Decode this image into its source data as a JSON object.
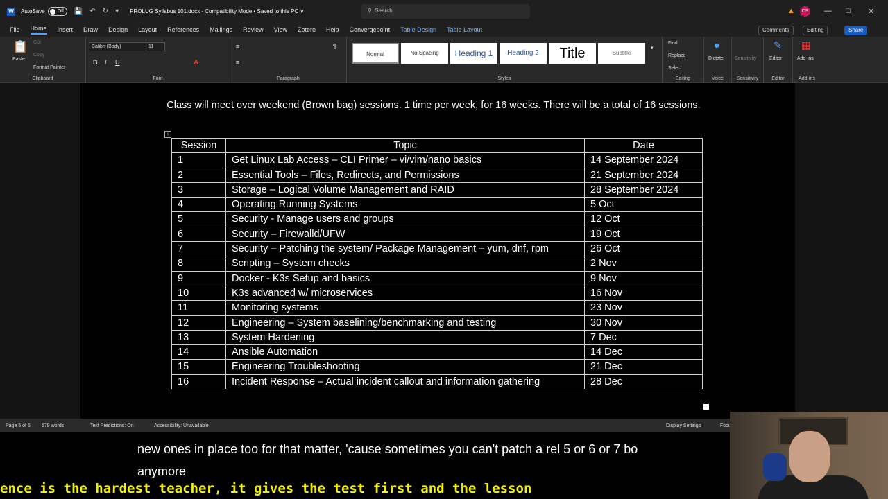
{
  "titlebar": {
    "autosave_label": "AutoSave",
    "autosave_state": "Off",
    "doc_title": "PROLUG Syllabus 101.docx  -  Compatibility Mode  •  Saved to this PC ∨",
    "search_placeholder": "Search",
    "avatar_initials": "CS"
  },
  "tabs": [
    "File",
    "Home",
    "Insert",
    "Draw",
    "Design",
    "Layout",
    "References",
    "Mailings",
    "Review",
    "View",
    "Zotero",
    "Help",
    "Convergepoint"
  ],
  "context_tabs": [
    "Table Design",
    "Table Layout"
  ],
  "active_tab": "Home",
  "top_right": {
    "comments": "Comments",
    "editing": "Editing",
    "share": "Share"
  },
  "ribbon": {
    "clipboard": {
      "paste": "Paste",
      "cut": "Cut",
      "copy": "Copy",
      "format_painter": "Format Painter",
      "label": "Clipboard"
    },
    "font": {
      "name": "Calibri (Body)",
      "size": "11",
      "label": "Font"
    },
    "paragraph": {
      "label": "Paragraph"
    },
    "styles": {
      "items": [
        "Normal",
        "No Spacing",
        "Heading 1",
        "Heading 2",
        "Title",
        "Subtitle"
      ],
      "label": "Styles"
    },
    "editing": {
      "find": "Find",
      "replace": "Replace",
      "select": "Select",
      "label": "Editing"
    },
    "voice": {
      "dictate": "Dictate",
      "label": "Voice"
    },
    "sensitivity": {
      "btn": "Sensitivity",
      "label": "Sensitivity"
    },
    "editor": {
      "btn": "Editor",
      "label": "Editor"
    },
    "addins": {
      "btn": "Add-ins",
      "label": "Add-ins"
    }
  },
  "document": {
    "intro": "Class will meet over weekend (Brown bag) sessions. 1 time per week, for 16 weeks. There will be a total of 16 sessions.",
    "table": {
      "headers": [
        "Session",
        "Topic",
        "Date"
      ],
      "rows": [
        [
          "1",
          "Get Linux Lab Access – CLI Primer – vi/vim/nano basics",
          "14 September 2024"
        ],
        [
          "2",
          "Essential Tools – Files, Redirects, and Permissions",
          "21 September 2024"
        ],
        [
          "3",
          "Storage – Logical Volume Management and RAID",
          "28 September 2024"
        ],
        [
          "4",
          "Operating Running Systems",
          "5 Oct"
        ],
        [
          "5",
          "Security - Manage users and groups",
          "12 Oct"
        ],
        [
          "6",
          "Security – Firewalld/UFW",
          "19 Oct"
        ],
        [
          "7",
          "Security – Patching the system/ Package Management – yum, dnf, rpm",
          "26 Oct"
        ],
        [
          "8",
          "Scripting – System checks",
          "2 Nov"
        ],
        [
          "9",
          "Docker - K3s Setup and basics",
          "9 Nov"
        ],
        [
          "10",
          "K3s advanced w/ microservices",
          "16 Nov"
        ],
        [
          "11",
          "Monitoring systems",
          "23 Nov"
        ],
        [
          "12",
          "Engineering – System baselining/benchmarking and testing",
          "30 Nov"
        ],
        [
          "13",
          "System Hardening",
          "7 Dec"
        ],
        [
          "14",
          "Ansible Automation",
          "14 Dec"
        ],
        [
          "15",
          "Engineering Troubleshooting",
          "21 Dec"
        ],
        [
          "16",
          "Incident Response – Actual incident callout and information gathering",
          "28 Dec"
        ]
      ]
    }
  },
  "statusbar": {
    "page": "Page 5 of 5",
    "words": "579 words",
    "text_predictions": "Text Predictions: On",
    "accessibility": "Accessibility: Unavailable",
    "display_settings": "Display Settings",
    "focus": "Focus"
  },
  "captions": {
    "line1": "new ones in place too for that matter, 'cause sometimes you can't patch a rel 5 or 6 or 7 bo",
    "line2": "anymore",
    "ticker": "ence is the hardest teacher, it gives the test first and the lesson"
  }
}
